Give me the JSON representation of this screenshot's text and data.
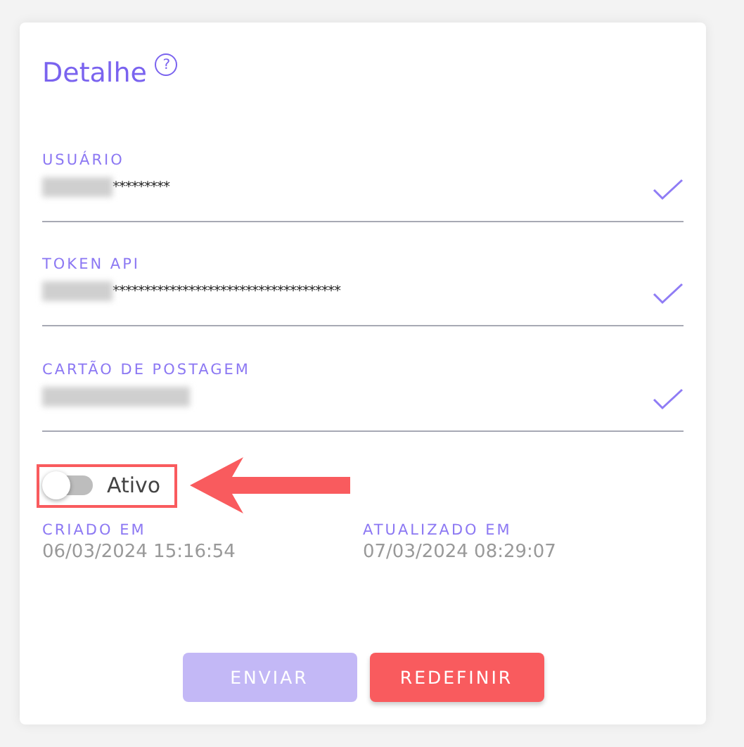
{
  "card": {
    "title": "Detalhe",
    "help_icon": "?"
  },
  "fields": [
    {
      "label": "USUÁRIO",
      "value": "*********",
      "valid": true
    },
    {
      "label": "TOKEN API",
      "value": "************************************",
      "valid": true
    },
    {
      "label": "CARTÃO DE POSTAGEM",
      "valid": true
    }
  ],
  "toggle": {
    "label": "Ativo",
    "checked": false
  },
  "dates": [
    {
      "label": "CRIADO EM",
      "value": "06/03/2024 15:16:54"
    },
    {
      "label": "ATUALIZADO EM",
      "value": "07/03/2024 08:29:07"
    }
  ],
  "buttons": [
    {
      "label": "ENVIAR",
      "kind": "primary",
      "disabled": true
    },
    {
      "label": "REDEFINIR",
      "kind": "danger",
      "disabled": false
    }
  ]
}
